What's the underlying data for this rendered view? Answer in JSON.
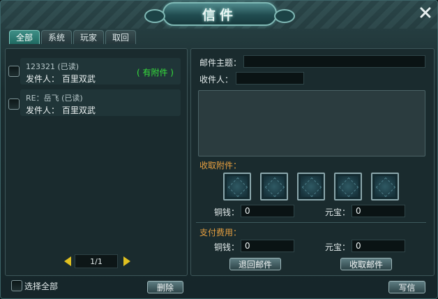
{
  "window": {
    "title": "信件"
  },
  "tabs": [
    {
      "label": "全部",
      "active": true
    },
    {
      "label": "系统",
      "active": false
    },
    {
      "label": "玩家",
      "active": false
    },
    {
      "label": "取回",
      "active": false
    }
  ],
  "mail_list": [
    {
      "subject": "123321 (已读)",
      "sender": "发件人： 百里双武",
      "attachment": "( 有附件 )"
    },
    {
      "subject": "RE：岳飞 (已读)",
      "sender": "发件人： 百里双武",
      "attachment": ""
    }
  ],
  "pager": {
    "page": "1/1"
  },
  "footer": {
    "select_all": "选择全部",
    "delete_label": "删除",
    "write_label": "写信"
  },
  "compose": {
    "subject_label": "邮件主题：",
    "subject_value": "",
    "recipient_label": "收件人：",
    "recipient_value": "",
    "body_value": "",
    "attachments_label": "收取附件：",
    "copper_label": "铜钱：",
    "copper_value": "0",
    "yuanbao_label": "元宝：",
    "yuanbao_value": "0",
    "payment_label": "支付费用：",
    "pay_copper_label": "铜钱：",
    "pay_copper_value": "0",
    "pay_yuanbao_label": "元宝：",
    "pay_yuanbao_value": "0",
    "return_label": "退回邮件",
    "collect_label": "收取邮件"
  },
  "icons": {
    "close": "close-icon",
    "prev": "prev-arrow-icon",
    "next": "next-arrow-icon",
    "slot": "attachment-slot-icon"
  },
  "colors": {
    "attachment_text": "#36e03c",
    "section_label": "#e8a040",
    "active_tab": "#2f7f77"
  }
}
